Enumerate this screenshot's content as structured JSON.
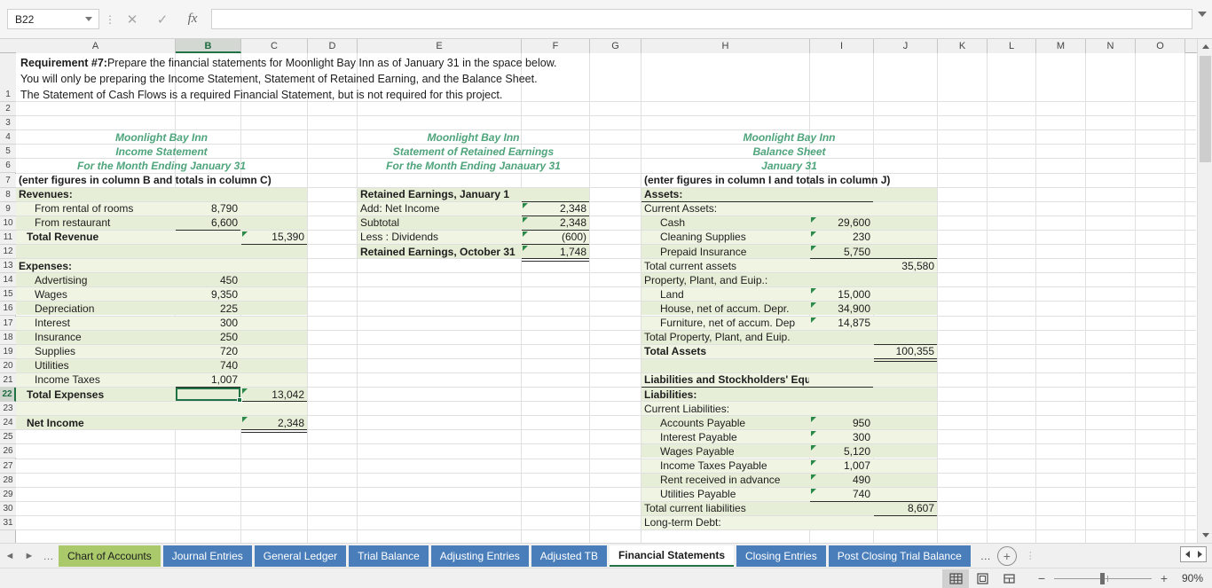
{
  "formula_bar": {
    "name_box_value": "B22",
    "formula_value": "",
    "cancel_icon": "close-icon",
    "confirm_icon": "check-icon",
    "function_icon": "fx-icon"
  },
  "columns": [
    "A",
    "B",
    "C",
    "D",
    "E",
    "F",
    "G",
    "H",
    "I",
    "J",
    "K",
    "L",
    "M",
    "N",
    "O"
  ],
  "selected_column": "B",
  "selected_row": 22,
  "rows": [
    1,
    2,
    3,
    4,
    5,
    6,
    7,
    8,
    9,
    10,
    11,
    12,
    13,
    14,
    15,
    16,
    17,
    18,
    19,
    20,
    21,
    22,
    23,
    24,
    25,
    26,
    27,
    28,
    29,
    30,
    31
  ],
  "requirement": {
    "line1_bold": "Requirement #7:",
    "line1_rest": " Prepare the financial statements for Moonlight Bay Inn as of January 31 in the space below.",
    "line2": "You will only be preparing the Income Statement, Statement of Retained Earning, and the Balance Sheet.",
    "line3": "The Statement of Cash Flows is a required Financial Statement, but is not required for this project."
  },
  "income_statement": {
    "title1": "Moonlight Bay Inn",
    "title2": "Income Statement",
    "title3": "For the Month Ending January 31",
    "instruction": "(enter figures in column B and totals in column C)",
    "revenues_header": "Revenues:",
    "revenue_rows": [
      {
        "label": "From rental of rooms",
        "value": "8,790"
      },
      {
        "label": "From restaurant",
        "value": "6,600"
      }
    ],
    "total_revenue_label": "Total Revenue",
    "total_revenue_value": "15,390",
    "expenses_header": "Expenses:",
    "expense_rows": [
      {
        "label": "Advertising",
        "value": "450"
      },
      {
        "label": "Wages",
        "value": "9,350"
      },
      {
        "label": "Depreciation",
        "value": "225"
      },
      {
        "label": "Interest",
        "value": "300"
      },
      {
        "label": "Insurance",
        "value": "250"
      },
      {
        "label": "Supplies",
        "value": "720"
      },
      {
        "label": "Utilities",
        "value": "740"
      },
      {
        "label": "Income Taxes",
        "value": "1,007"
      }
    ],
    "total_expenses_label": "Total Expenses",
    "total_expenses_value": "13,042",
    "net_income_label": "Net Income",
    "net_income_value": "2,348"
  },
  "retained_earnings": {
    "title1": "Moonlight Bay Inn",
    "title2": "Statement of Retained Earnings",
    "title3": "For the Month Ending Janauary 31",
    "rows": [
      {
        "label": "Retained Earnings, January 1",
        "value": ""
      },
      {
        "label": "Add: Net Income",
        "value": "2,348"
      },
      {
        "label": "Subtotal",
        "value": "2,348"
      },
      {
        "label": "Less : Dividends",
        "value": "(600)"
      },
      {
        "label": "Retained Earnings, October 31",
        "value": "1,748"
      }
    ]
  },
  "balance_sheet": {
    "title1": "Moonlight Bay Inn",
    "title2": "Balance Sheet",
    "title3": "January 31",
    "instruction": "(enter figures in column I and totals in column J)",
    "assets_header": "Assets:",
    "current_assets_header": "Current Assets:",
    "current_assets": [
      {
        "label": "Cash",
        "value": "29,600"
      },
      {
        "label": "Cleaning Supplies",
        "value": "230"
      },
      {
        "label": "Prepaid Insurance",
        "value": "5,750"
      }
    ],
    "total_current_assets_label": "Total current assets",
    "total_current_assets_value": "35,580",
    "ppe_header": "Property, Plant, and Euip.:",
    "ppe_rows": [
      {
        "label": "Land",
        "value": "15,000"
      },
      {
        "label": "House, net of accum. Depr.",
        "value": "34,900"
      },
      {
        "label": "Furniture, net of accum. Dep",
        "value": "14,875"
      }
    ],
    "total_ppe_label": "Total Property, Plant, and Euip.",
    "total_ppe_value": "",
    "total_assets_label": "Total Assets",
    "total_assets_value": "100,355",
    "liab_equity_header": "Liabilities and Stockholders' Equity",
    "liabilities_header": "Liabilities:",
    "current_liabilities_header": "Current Liabilities:",
    "current_liabilities": [
      {
        "label": "Accounts Payable",
        "value": "950"
      },
      {
        "label": "Interest Payable",
        "value": "300"
      },
      {
        "label": "Wages Payable",
        "value": "5,120"
      },
      {
        "label": "Income Taxes Payable",
        "value": "1,007"
      },
      {
        "label": "Rent received in advance",
        "value": "490"
      },
      {
        "label": "Utilities Payable",
        "value": "740"
      }
    ],
    "total_current_liabilities_label": "Total current liabilities",
    "total_current_liabilities_value": "8,607",
    "longterm_debt_header": "Long-term Debt:"
  },
  "sheet_tabs": {
    "prev_icon": "arrow-left-icon",
    "next_icon": "arrow-right-icon",
    "overflow_left": "…",
    "overflow_right": "…",
    "add_icon": "plus-icon",
    "tabs": [
      {
        "label": "Chart of Accounts",
        "state": "green"
      },
      {
        "label": "Journal Entries",
        "state": "normal"
      },
      {
        "label": "General Ledger",
        "state": "normal"
      },
      {
        "label": "Trial Balance",
        "state": "normal"
      },
      {
        "label": "Adjusting Entries",
        "state": "normal"
      },
      {
        "label": "Adjusted TB",
        "state": "normal"
      },
      {
        "label": "Financial Statements",
        "state": "active"
      },
      {
        "label": "Closing Entries",
        "state": "normal"
      },
      {
        "label": "Post Closing Trial Balance",
        "state": "normal"
      }
    ]
  },
  "status_bar": {
    "normal_view_icon": "grid-view-icon",
    "page_layout_icon": "page-layout-icon",
    "page_break_icon": "page-break-icon",
    "zoom_out_label": "−",
    "zoom_in_label": "+",
    "zoom_level": "90%"
  },
  "colors": {
    "accent_green": "#217346",
    "title_green": "#4ea47b",
    "band_dark": "#e7eed7",
    "band_light": "#eff4e3",
    "tab_blue": "#4a7ebb",
    "tab_green": "#a9c96a"
  }
}
